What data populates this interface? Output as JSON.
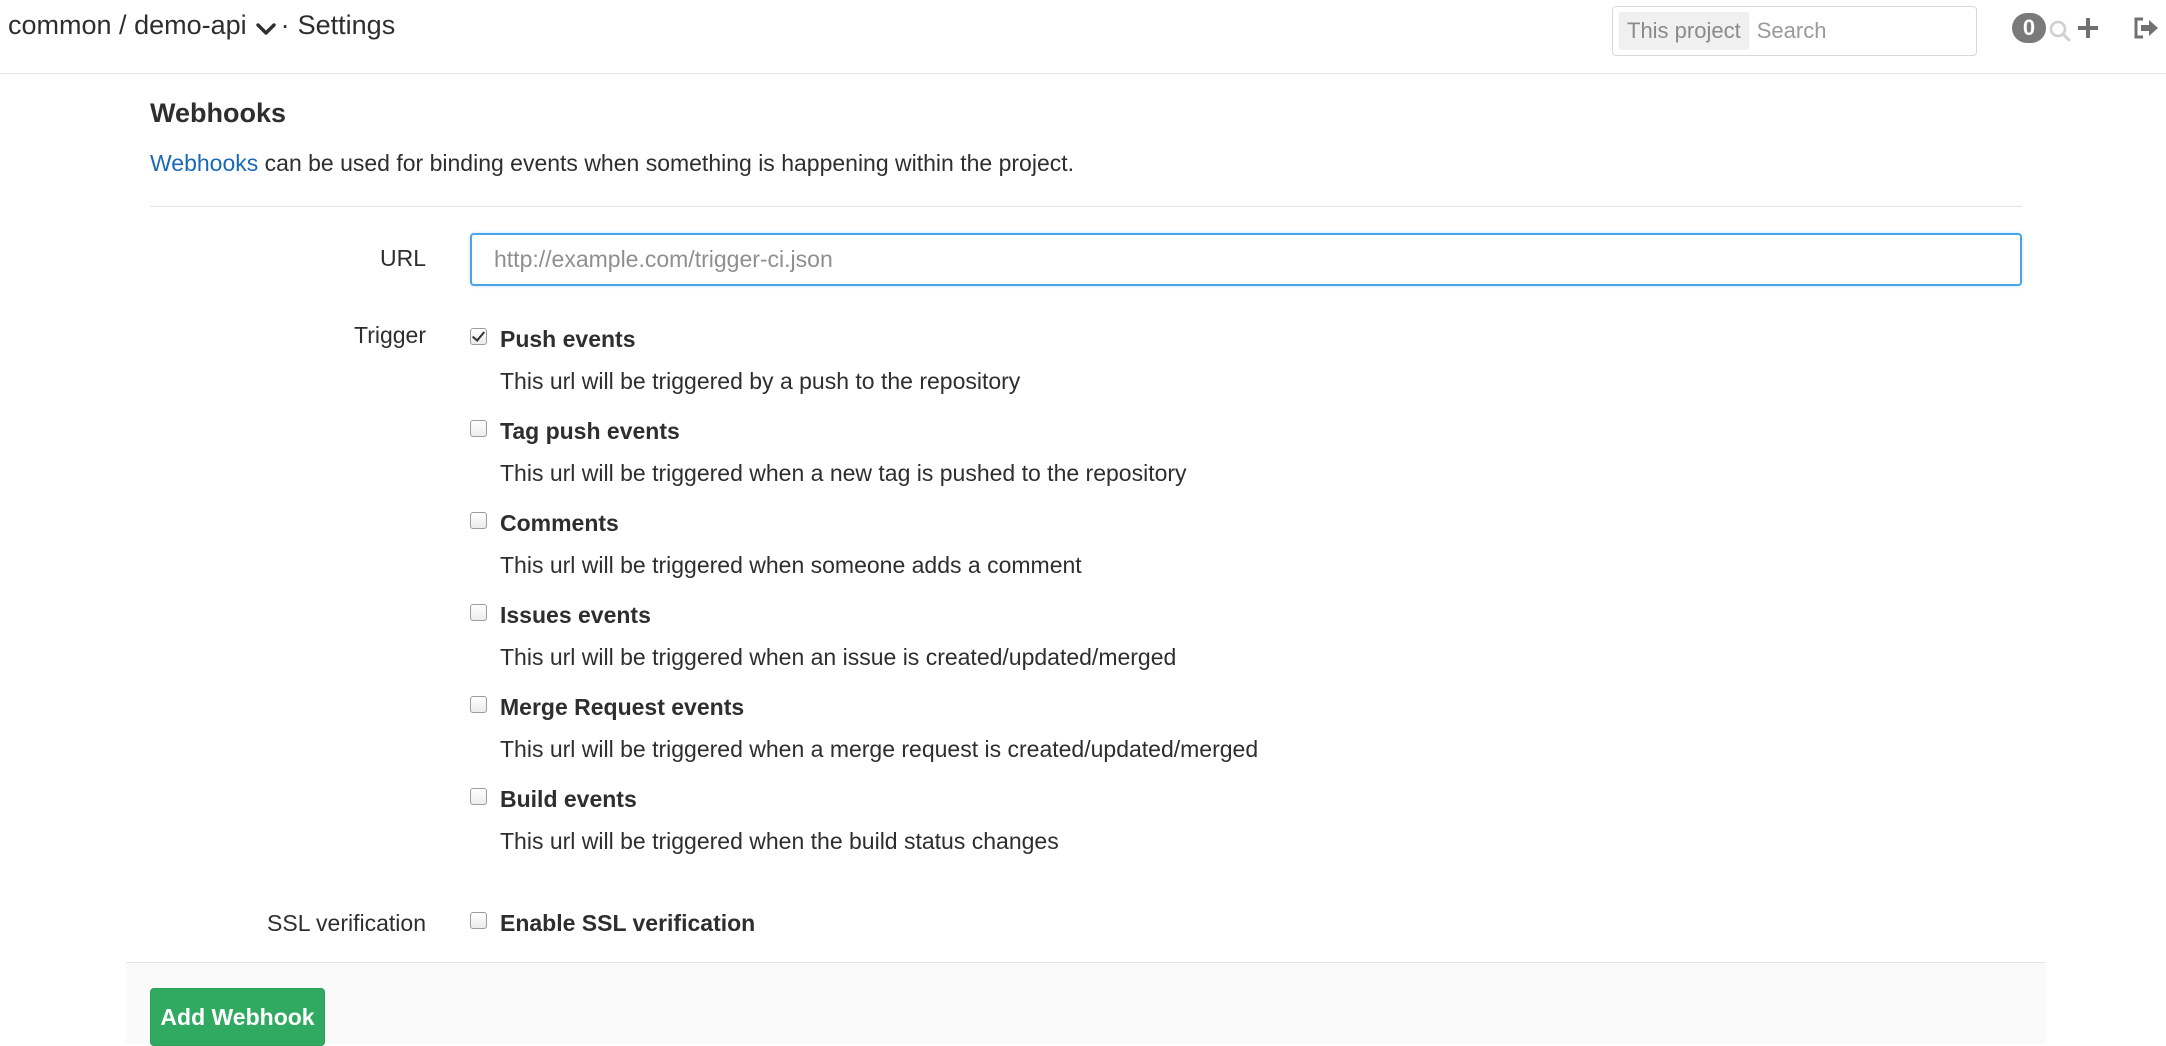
{
  "header": {
    "breadcrumb": {
      "namespace": "common",
      "separator": "/",
      "project": "demo-api",
      "dot": "·",
      "page": "Settings"
    },
    "search": {
      "scope_label": "This project",
      "placeholder": "Search"
    },
    "counter": "0",
    "icons": [
      "chevron-down-icon",
      "search-icon",
      "plus-icon",
      "sign-out-icon"
    ]
  },
  "webhooks": {
    "title": "Webhooks",
    "description_link": "Webhooks",
    "description_rest": " can be used for binding events when something is happening within the project.",
    "url": {
      "label": "URL",
      "value": "",
      "placeholder": "http://example.com/trigger-ci.json"
    },
    "trigger_label": "Trigger",
    "triggers": [
      {
        "title": "Push events",
        "help": "This url will be triggered by a push to the repository",
        "checked": true
      },
      {
        "title": "Tag push events",
        "help": "This url will be triggered when a new tag is pushed to the repository",
        "checked": false
      },
      {
        "title": "Comments",
        "help": "This url will be triggered when someone adds a comment",
        "checked": false
      },
      {
        "title": "Issues events",
        "help": "This url will be triggered when an issue is created/updated/merged",
        "checked": false
      },
      {
        "title": "Merge Request events",
        "help": "This url will be triggered when a merge request is created/updated/merged",
        "checked": false
      },
      {
        "title": "Build events",
        "help": "This url will be triggered when the build status changes",
        "checked": false
      }
    ],
    "ssl": {
      "label": "SSL verification",
      "option": "Enable SSL verification",
      "checked": false
    },
    "submit_label": "Add Webhook"
  },
  "colors": {
    "link": "#1b69b6",
    "focus_border": "#4aa4e6",
    "primary_button": "#2faa60",
    "badge": "#7a7a7a"
  }
}
